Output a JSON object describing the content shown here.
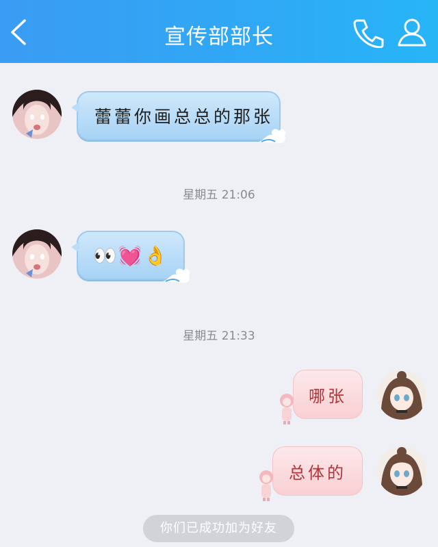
{
  "header": {
    "title": "宣传部部长",
    "icons": {
      "back": "chevron-left-icon",
      "call": "phone-icon",
      "profile": "person-icon"
    },
    "bg_color": "#2fa9f5"
  },
  "messages": [
    {
      "side": "in",
      "text": "蕾蕾你画总总的那张"
    },
    {
      "side": "in",
      "emoji": "👀💓👌"
    },
    {
      "side": "out",
      "text": "哪张"
    },
    {
      "side": "out",
      "text": "总体的"
    }
  ],
  "timestamps": [
    "星期五 21:06",
    "星期五 21:33"
  ],
  "system_notice": "你们已成功加为好友"
}
